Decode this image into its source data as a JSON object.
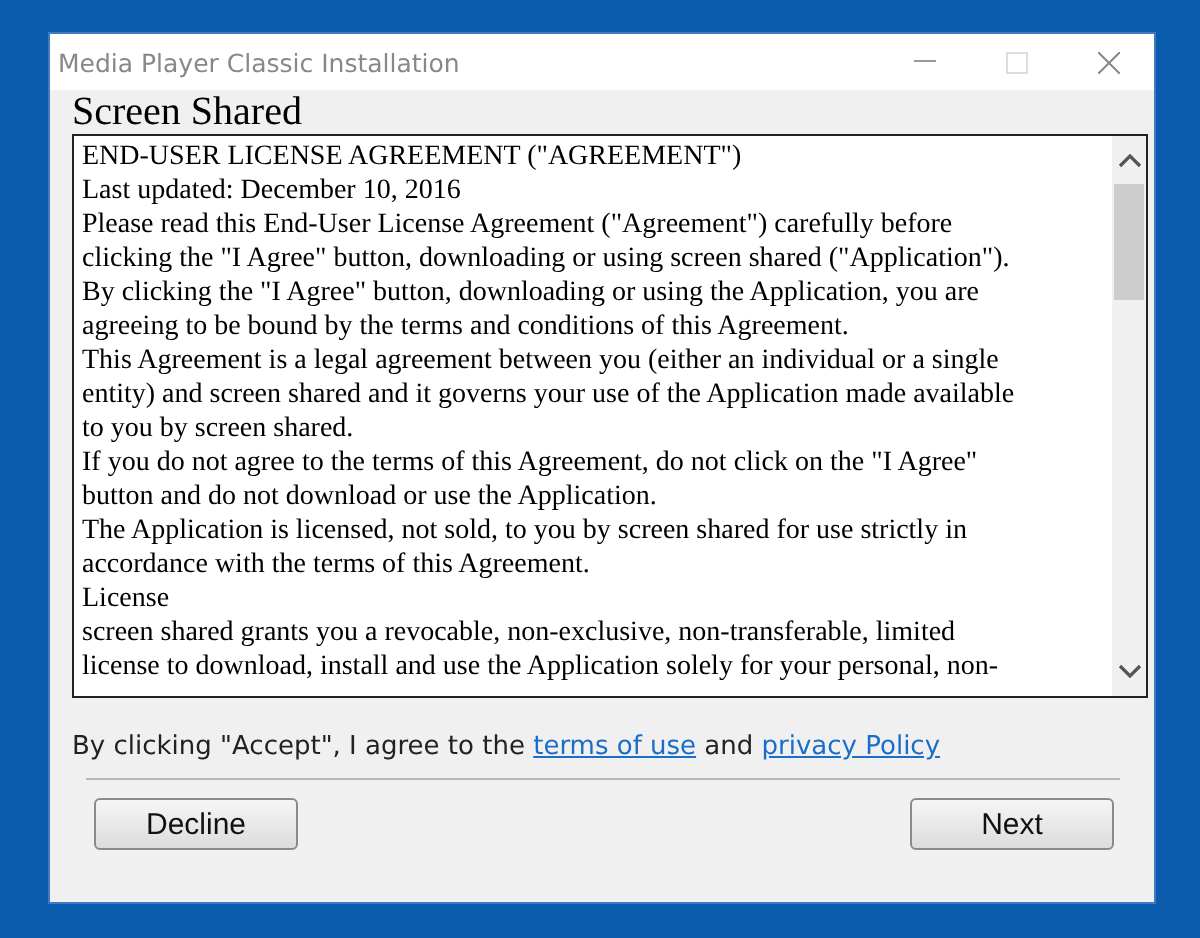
{
  "window": {
    "title": "Media Player Classic Installation"
  },
  "heading": "Screen Shared",
  "license_lines": [
    "END-USER LICENSE AGREEMENT (\"AGREEMENT\")",
    "Last updated: December 10, 2016",
    "Please read this End-User License Agreement (\"Agreement\") carefully before",
    "clicking the \"I Agree\" button, downloading or using screen shared (\"Application\").",
    "By clicking the \"I Agree\" button, downloading or using the Application, you are",
    "agreeing to be bound by the terms and conditions of this Agreement.",
    "This Agreement is a legal agreement between you (either an individual or a single",
    "entity) and screen shared and it governs your use of the Application made available",
    "to you by screen shared.",
    "If you do not agree to the terms of this Agreement, do not click on the \"I Agree\"",
    "button and do not download or use the Application.",
    "The Application is licensed, not sold, to you by screen shared for use strictly in",
    "accordance with the terms of this Agreement.",
    "License",
    "screen shared grants you a revocable, non-exclusive, non-transferable, limited",
    "license to download, install and use the Application solely for your personal, non-"
  ],
  "consent": {
    "before": "By clicking \"Accept\", I agree to the ",
    "link_1": "terms of use",
    "between": " and ",
    "link_2": "privacy Policy"
  },
  "buttons": {
    "decline": "Decline",
    "next": "Next"
  }
}
